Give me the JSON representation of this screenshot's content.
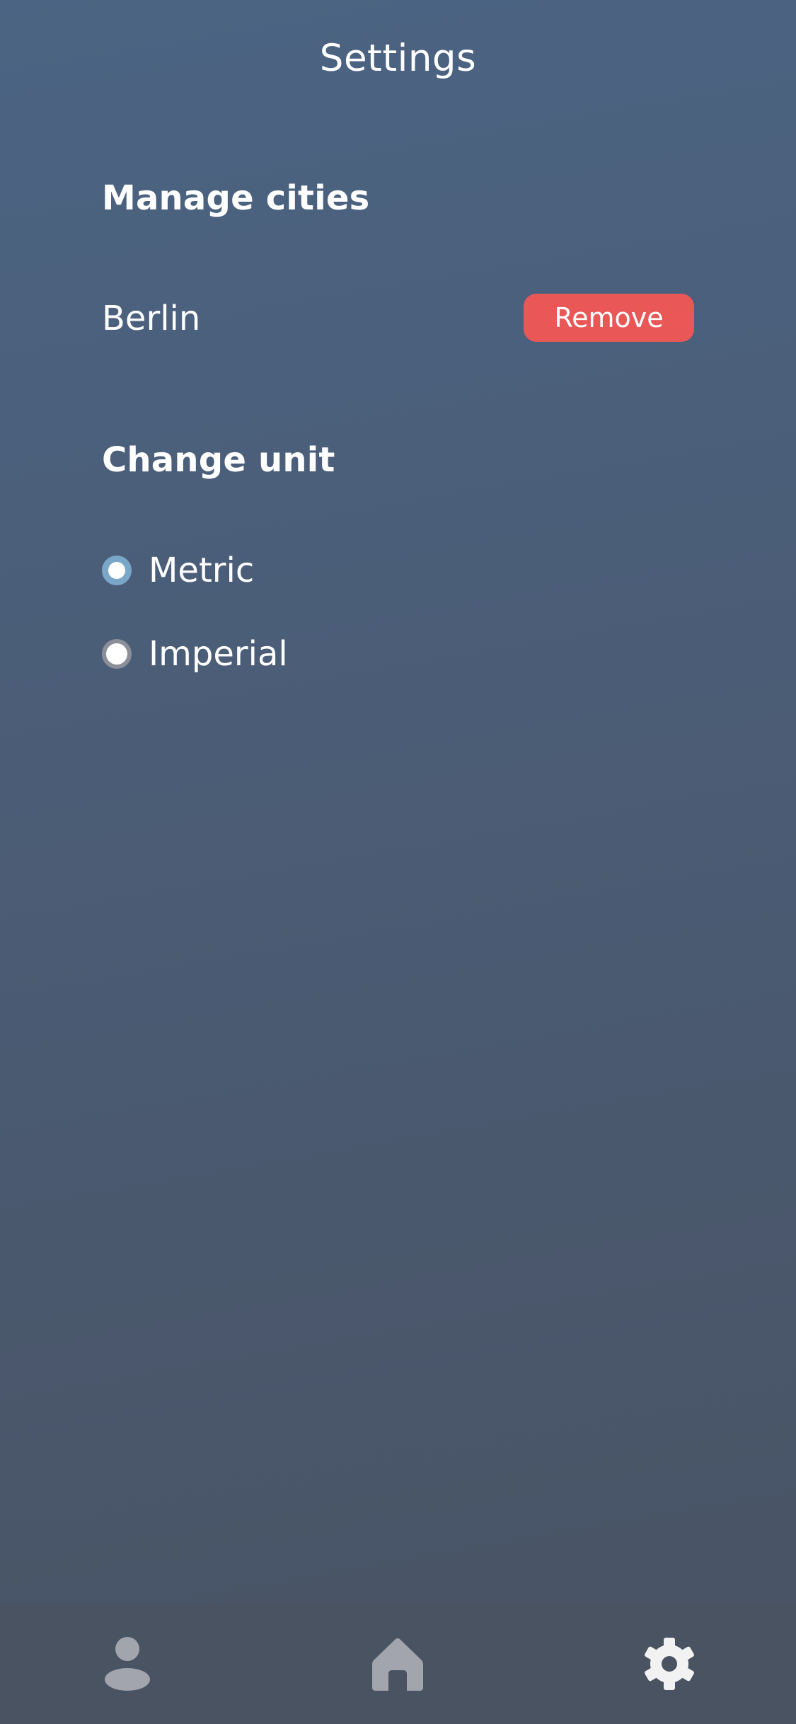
{
  "header": {
    "title": "Settings"
  },
  "manage_cities": {
    "heading": "Manage cities",
    "cities": [
      {
        "name": "Berlin",
        "remove_label": "Remove"
      }
    ]
  },
  "change_unit": {
    "heading": "Change unit",
    "options": [
      {
        "label": "Metric",
        "selected": true
      },
      {
        "label": "Imperial",
        "selected": false
      }
    ]
  },
  "bottom_nav": {
    "items": [
      {
        "icon": "profile-icon",
        "active": false
      },
      {
        "icon": "home-icon",
        "active": false
      },
      {
        "icon": "gear-icon",
        "active": true
      }
    ]
  },
  "colors": {
    "remove_button": "#ea5757",
    "radio_selected": "#7aa7c7",
    "nav_background": "#4a5362",
    "nav_icon_inactive": "#a2a5ad",
    "nav_icon_active": "#f2f2f2"
  }
}
